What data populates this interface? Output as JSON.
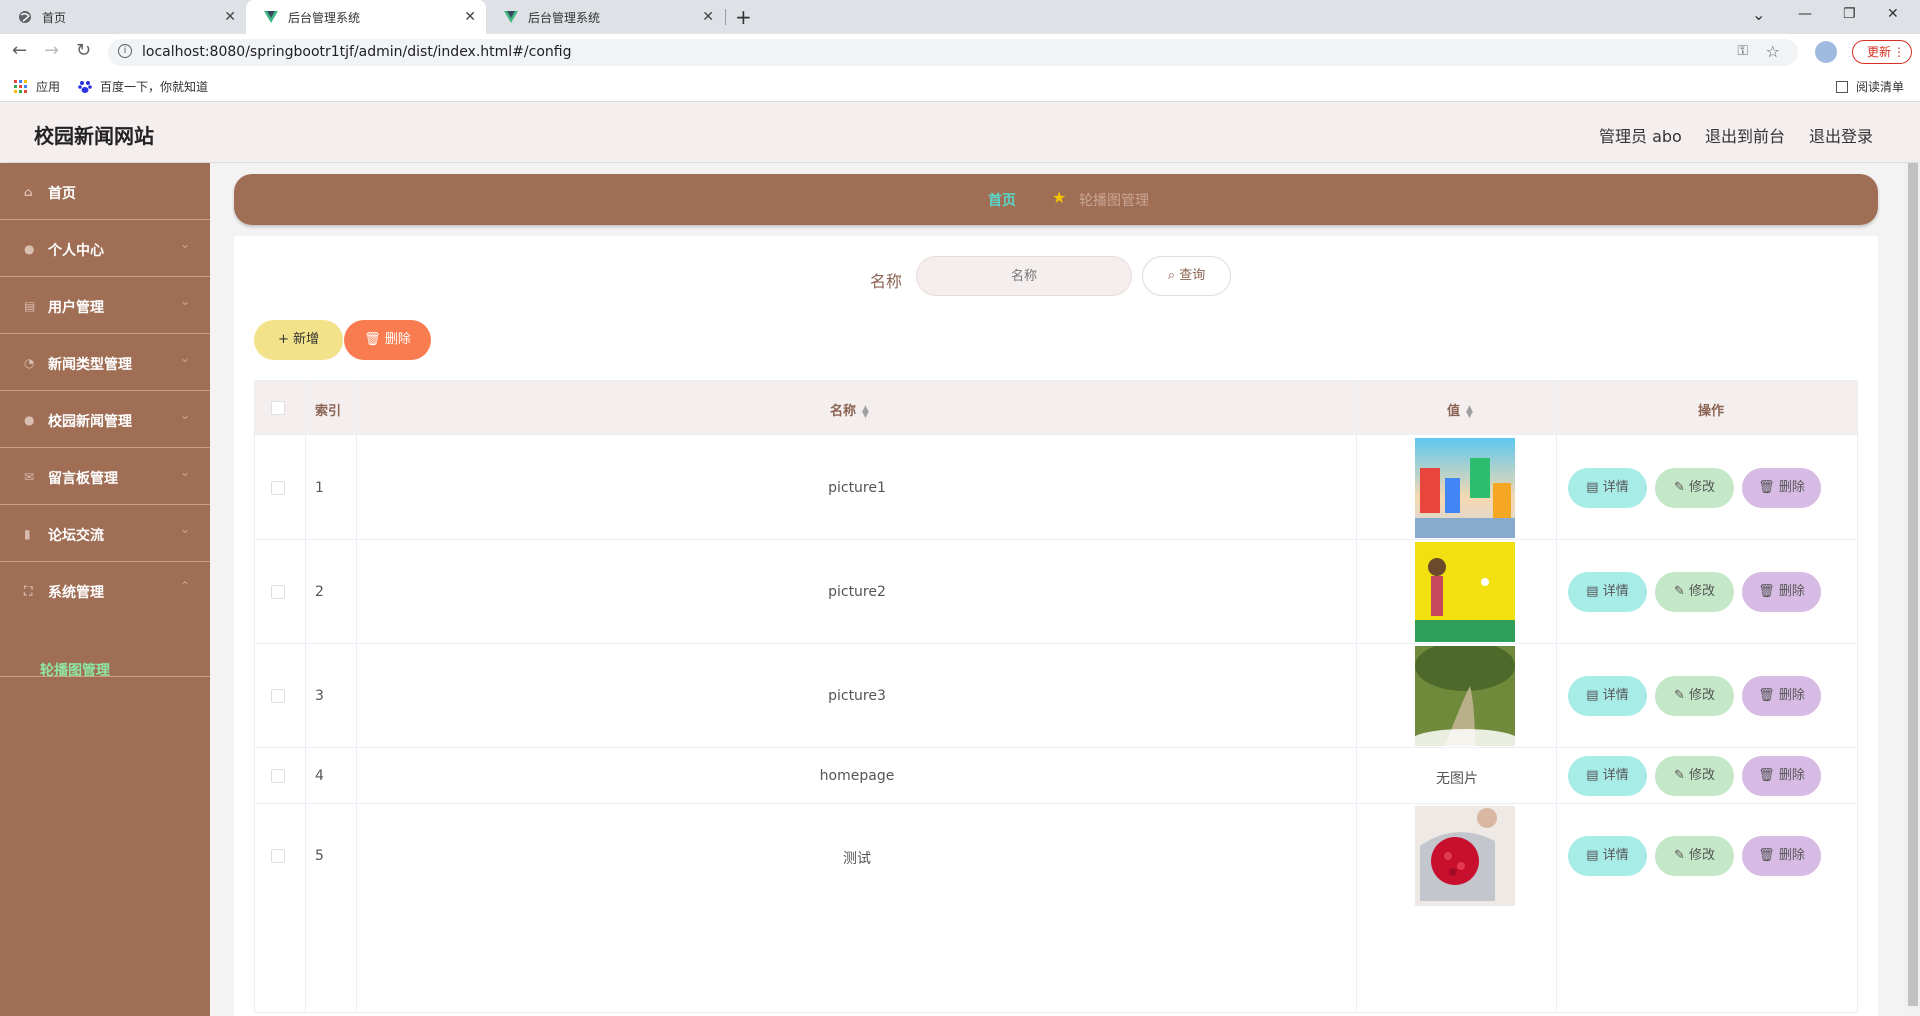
{
  "browser": {
    "tabs": [
      {
        "title": "首页",
        "icon": "globe-icon"
      },
      {
        "title": "后台管理系统",
        "icon": "vue-logo-icon"
      },
      {
        "title": "后台管理系统",
        "icon": "vue-logo-icon"
      }
    ],
    "url": "localhost:8080/springbootr1tjf/admin/dist/index.html#/config",
    "update_label": "更新",
    "bookmarks": [
      {
        "label": "应用",
        "icon": "apps-grid-icon"
      },
      {
        "label": "百度一下，你就知道",
        "icon": "baidu-paw-icon"
      }
    ],
    "reading_list": "阅读清单"
  },
  "header": {
    "title": "校园新闻网站",
    "admin": "管理员 abo",
    "to_front": "退出到前台",
    "logout": "退出登录"
  },
  "sidebar": {
    "items": [
      {
        "label": "首页",
        "icon": "home-icon"
      },
      {
        "label": "个人中心",
        "icon": "user-icon"
      },
      {
        "label": "用户管理",
        "icon": "clipboard-icon"
      },
      {
        "label": "新闻类型管理",
        "icon": "clock-icon"
      },
      {
        "label": "校园新闻管理",
        "icon": "user-icon"
      },
      {
        "label": "留言板管理",
        "icon": "message-icon"
      },
      {
        "label": "论坛交流",
        "icon": "chart-icon"
      },
      {
        "label": "系统管理",
        "icon": "system-icon"
      }
    ],
    "sub_item": "轮播图管理"
  },
  "breadcrumb": {
    "home": "首页",
    "current": "轮播图管理"
  },
  "search": {
    "label": "名称",
    "placeholder": "名称",
    "button": "查询"
  },
  "actions": {
    "add": "新增",
    "delete": "删除"
  },
  "table": {
    "headers": {
      "index": "索引",
      "name": "名称",
      "value": "值",
      "ops": "操作"
    },
    "rows": [
      {
        "index": "1",
        "name": "picture1",
        "value": "",
        "image": "colorful-banner"
      },
      {
        "index": "2",
        "name": "picture2",
        "value": "",
        "image": "yellow-banner"
      },
      {
        "index": "3",
        "name": "picture3",
        "value": "",
        "image": "garden-photo"
      },
      {
        "index": "4",
        "name": "homepage",
        "value": "无图片",
        "image": ""
      },
      {
        "index": "5",
        "name": "测试",
        "value": "",
        "image": "roses-photo"
      }
    ],
    "row_buttons": {
      "detail": "详情",
      "edit": "修改",
      "delete": "删除"
    }
  },
  "colors": {
    "sidebar": "#a06e55",
    "header": "#f4efee",
    "accent_home": "#57d6c8",
    "add_button": "#f2e28a",
    "delete_button": "#f87c4f"
  }
}
